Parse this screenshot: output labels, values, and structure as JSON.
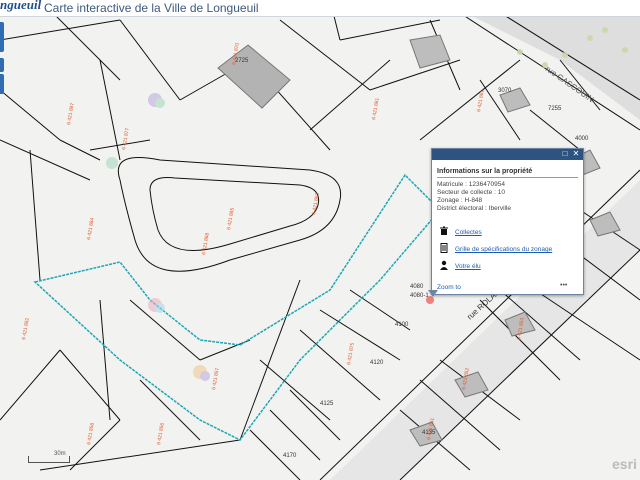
{
  "header": {
    "logo": "ngueuil",
    "title": "Carte interactive de la Ville de Longueuil"
  },
  "map": {
    "street": "rue ROLAND",
    "street_upper": "rue GASCOUIN",
    "civic_numbers": [
      "2725",
      "7255",
      "4000",
      "4080",
      "4080-1",
      "4100",
      "4120",
      "4125",
      "4135",
      "4170",
      "3070"
    ],
    "lot_prefix": "6 421",
    "scale_label": "30m",
    "attribution": "esri"
  },
  "popup": {
    "title": "Informations sur la propriété",
    "matricule": "Matricule : 1236470954",
    "secteur": "Secteur de collecte : 10",
    "zonage": "Zonage : H-848",
    "district": "District électoral : Iberville",
    "links": [
      {
        "label": "Collectes",
        "icon": "trash-icon"
      },
      {
        "label": "Grille de spécifications du zonage",
        "icon": "document-icon"
      },
      {
        "label": "Votre élu",
        "icon": "person-icon"
      }
    ],
    "zoom_to": "Zoom to",
    "more": "•••"
  },
  "colors": {
    "header_bar": "#2d5480",
    "parcel_highlight": "#1ea7b5",
    "lot_labels": "#e25b2a",
    "link": "#1d5bb3"
  }
}
